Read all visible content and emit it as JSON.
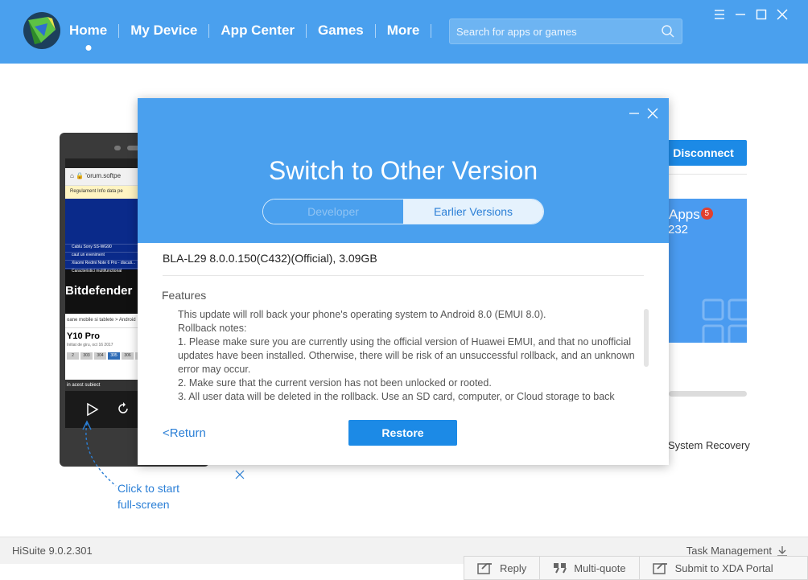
{
  "topbar": {
    "nav": [
      "Home",
      "My Device",
      "App Center",
      "Games",
      "More"
    ],
    "active_nav": "Home",
    "search_placeholder": "Search for apps or games",
    "accent_color": "#4aa0ee"
  },
  "background": {
    "phone_screen": {
      "url_text": "'orum.softpe",
      "banner_text": "Regulament    Info data pe",
      "links": [
        "Cablu Sony SS-WG90",
        "caut un eveniment",
        "Xiaomi Redmi Note 6 Pro - discuti...",
        "Caracteristici multifunctional"
      ],
      "ad_text": "Bitdefender",
      "crumb_text": "oane mobile si tablete  >  Android",
      "title_text": "Y10 Pro",
      "sub_text": "Initiat de giru, oct 16 2017",
      "pages": [
        "2",
        "303",
        "304",
        "305",
        "306",
        "305"
      ],
      "active_page": "305",
      "footer_text": "in acest subiect"
    },
    "hint": {
      "text": "Click to start\nfull-screen"
    },
    "disconnect_label": "Disconnect",
    "apps_card": {
      "label": "Apps",
      "badge": "5",
      "count": "232"
    },
    "system_recovery_label": "System Recovery"
  },
  "dialog": {
    "title": "Switch to Other Version",
    "tabs": [
      "Developer",
      "Earlier Versions"
    ],
    "active_tab": "Earlier Versions",
    "version_line": "BLA-L29 8.0.0.150(C432)(Official), 3.09GB",
    "features_label": "Features",
    "notes": [
      "This update will roll back your phone's operating system to Android 8.0 (EMUI 8.0).",
      "Rollback notes:",
      "1. Please make sure you are currently using the official version of Huawei EMUI, and that no unofficial updates have been installed. Otherwise, there will be risk of an unsuccessful rollback, and an unknown error may occur.",
      "2. Make sure that the current version has not been unlocked or rooted.",
      "3. All user data will be deleted in the rollback. Use an SD card, computer, or Cloud storage to back"
    ],
    "return_label": "<Return",
    "restore_label": "Restore"
  },
  "statusbar": {
    "version": "HiSuite 9.0.2.301",
    "task_label": "Task Management"
  },
  "forum_bar": {
    "buttons": [
      "Reply",
      "Multi-quote",
      "Submit to XDA Portal"
    ]
  }
}
